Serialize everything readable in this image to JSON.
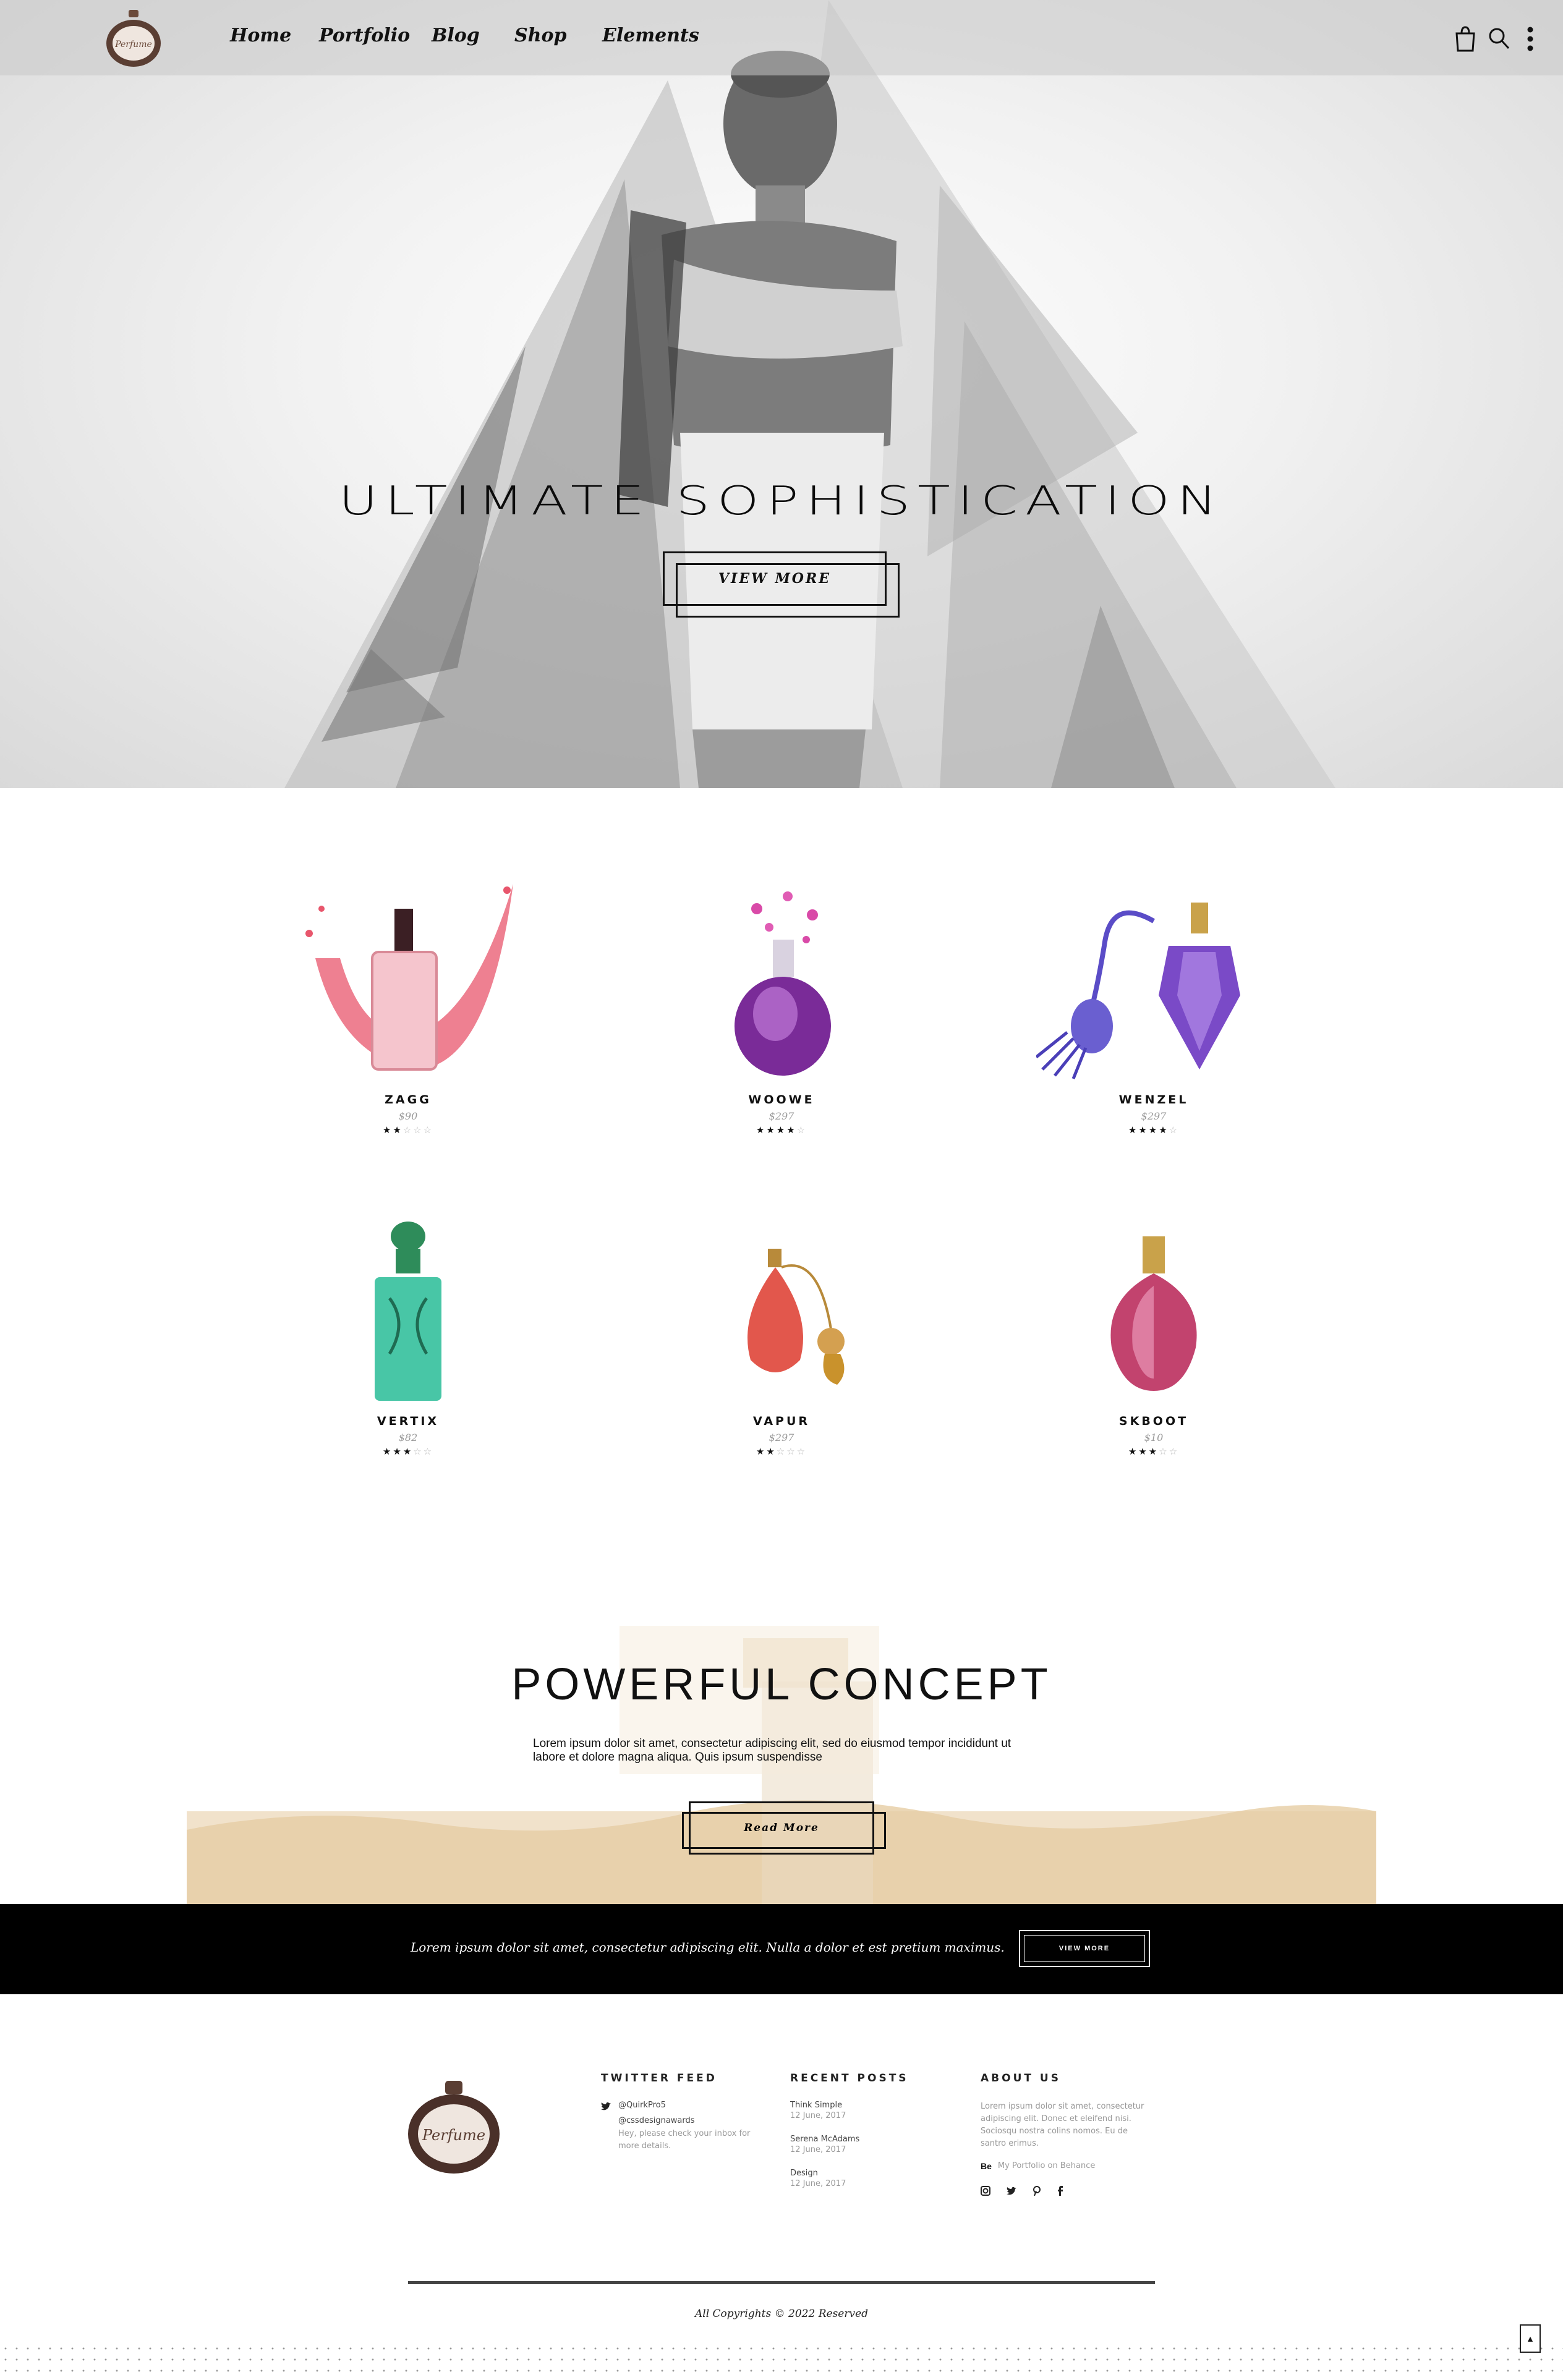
{
  "nav": {
    "logo_text": "Perfume",
    "links": [
      "Home",
      "Portfolio",
      "Blog",
      "Shop",
      "Elements"
    ],
    "icons": [
      "bag-icon",
      "search-icon",
      "more-vertical-icon"
    ]
  },
  "hero": {
    "title": "ULTIMATE SOPHISTICATION",
    "button": "VIEW MORE"
  },
  "products": [
    {
      "name": "ZAGG",
      "price": "$90",
      "rating": 2,
      "max": 5
    },
    {
      "name": "WOOWE",
      "price": "$297",
      "rating": 4,
      "max": 5
    },
    {
      "name": "WENZEL",
      "price": "$297",
      "rating": 4,
      "max": 5
    },
    {
      "name": "VERTIX",
      "price": "$82",
      "rating": 3,
      "max": 5
    },
    {
      "name": "VAPUR",
      "price": "$297",
      "rating": 2,
      "max": 5
    },
    {
      "name": "SKBOOT",
      "price": "$10",
      "rating": 3,
      "max": 5
    }
  ],
  "concept": {
    "title": "POWERFUL CONCEPT",
    "text": "Lorem ipsum dolor sit amet, consectetur adipiscing elit, sed do eiusmod tempor incididunt ut labore et dolore magna aliqua. Quis ipsum suspendisse",
    "button": "Read More"
  },
  "cta": {
    "text": "Lorem ipsum dolor sit amet, consectetur adipiscing elit. Nulla a dolor et est pretium maximus.",
    "button": "VIEW MORE"
  },
  "footer": {
    "logo_text": "Perfume",
    "twitter": {
      "heading": "TWITTER FEED",
      "handle": "@QuirkPro5",
      "mention": "@cssdesignawards",
      "message": "Hey, please check your inbox for more details."
    },
    "recent_posts": {
      "heading": "RECENT POSTS",
      "posts": [
        {
          "title": "Think Simple",
          "date": "12 June, 2017"
        },
        {
          "title": "Serena McAdams",
          "date": "12 June, 2017"
        },
        {
          "title": "Design",
          "date": "12 June, 2017"
        }
      ]
    },
    "about": {
      "heading": "ABOUT US",
      "text": "Lorem ipsum dolor sit amet, consectetur adipiscing elit. Donec et eleifend nisi. Sociosqu nostra colins nomos. Eu de santro erimus.",
      "behance_label": "Be",
      "behance_link": "My Portfolio on Behance",
      "social": [
        "instagram-icon",
        "twitter-icon",
        "pinterest-icon",
        "facebook-icon"
      ]
    },
    "copyright": "All Copyrights © 2022 Reserved"
  }
}
